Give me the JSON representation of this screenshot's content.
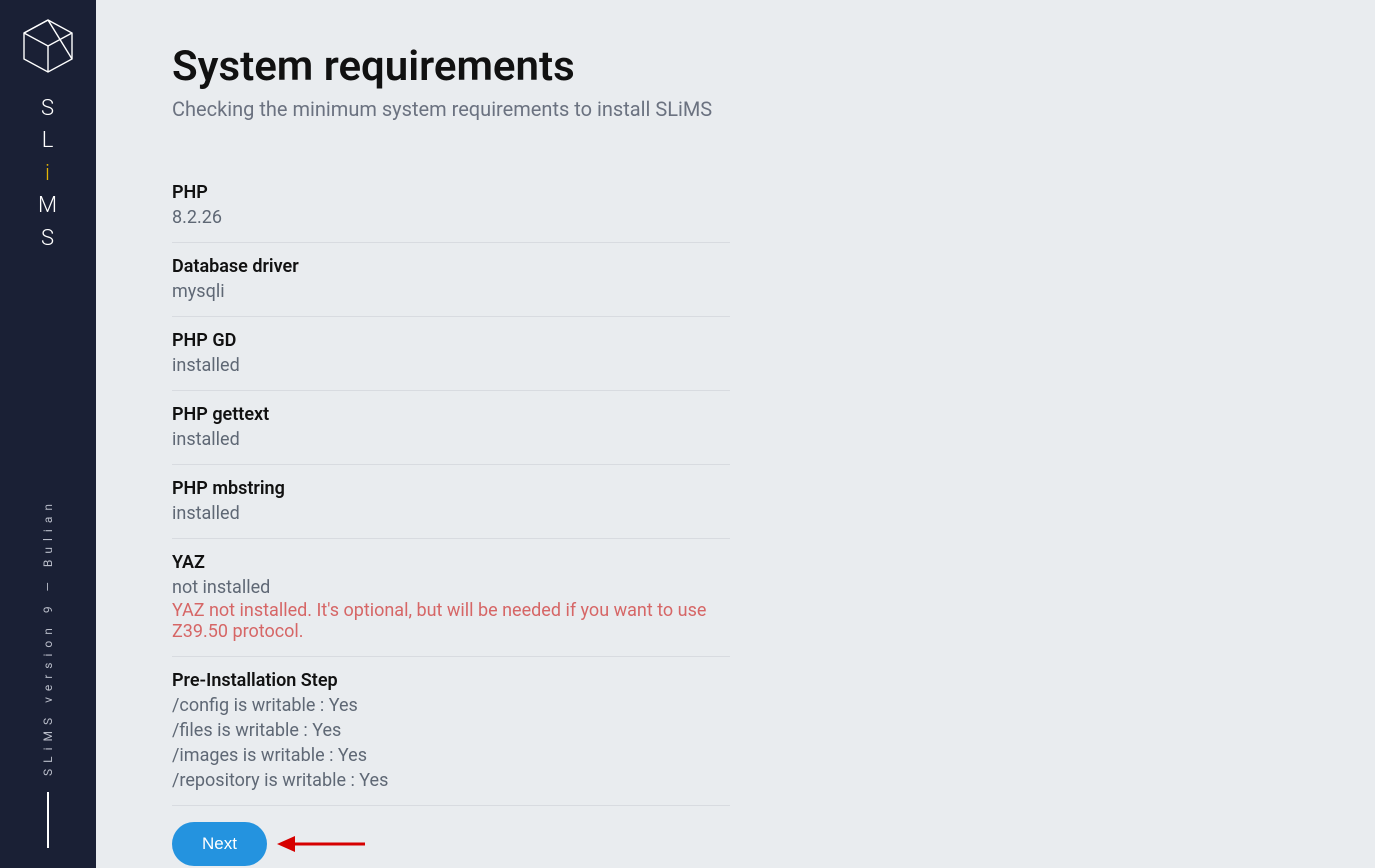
{
  "brand": {
    "letters": [
      "S",
      "L",
      "i",
      "M",
      "S"
    ],
    "accent_index": 2,
    "version_text": "SLiMS version 9 — Bulian"
  },
  "page": {
    "title": "System requirements",
    "subtitle": "Checking the minimum system requirements to install SLiMS"
  },
  "checks": [
    {
      "label": "PHP",
      "value": "8.2.26"
    },
    {
      "label": "Database driver",
      "value": "mysqli"
    },
    {
      "label": "PHP GD",
      "value": "installed"
    },
    {
      "label": "PHP gettext",
      "value": "installed"
    },
    {
      "label": "PHP mbstring",
      "value": "installed"
    },
    {
      "label": "YAZ",
      "value": "not installed",
      "warning": "YAZ not installed. It's optional, but will be needed if you want to use Z39.50 protocol."
    }
  ],
  "preinstall": {
    "label": "Pre-Installation Step",
    "lines": [
      "/config is writable : Yes",
      "/files is writable : Yes",
      "/images is writable : Yes",
      "/repository is writable : Yes"
    ]
  },
  "actions": {
    "next_label": "Next"
  }
}
